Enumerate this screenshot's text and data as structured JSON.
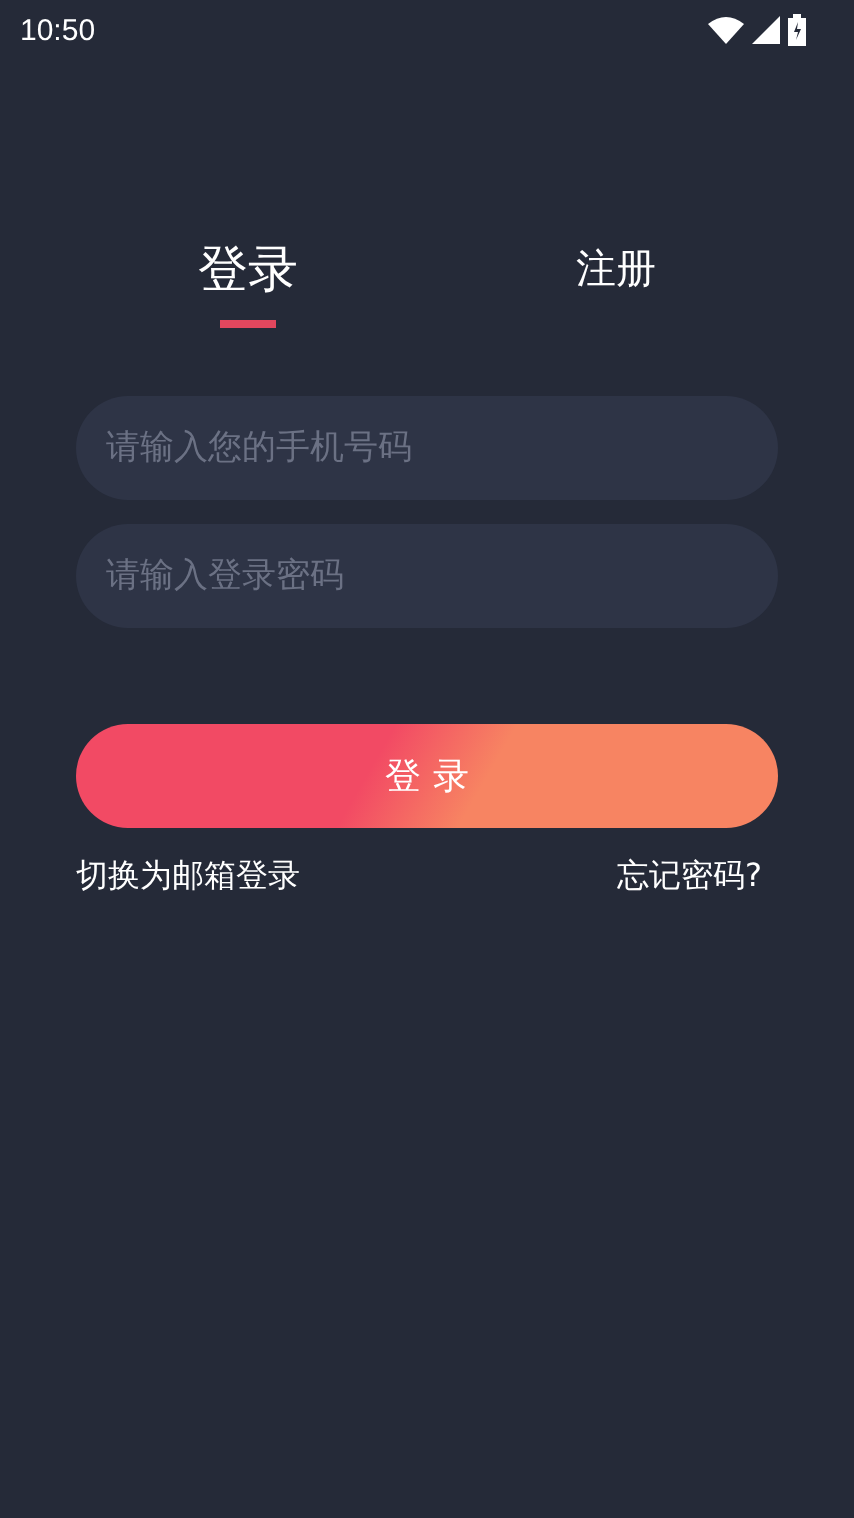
{
  "status_bar": {
    "time": "10:50"
  },
  "tabs": [
    {
      "label": "登录",
      "selected": true
    },
    {
      "label": "注册",
      "selected": false
    }
  ],
  "fields": [
    {
      "placeholder": "请输入您的手机号码"
    },
    {
      "placeholder": "请输入登录密码"
    }
  ],
  "login_button": "登 录",
  "links": [
    "切换为邮箱登录",
    "忘记密码?"
  ]
}
